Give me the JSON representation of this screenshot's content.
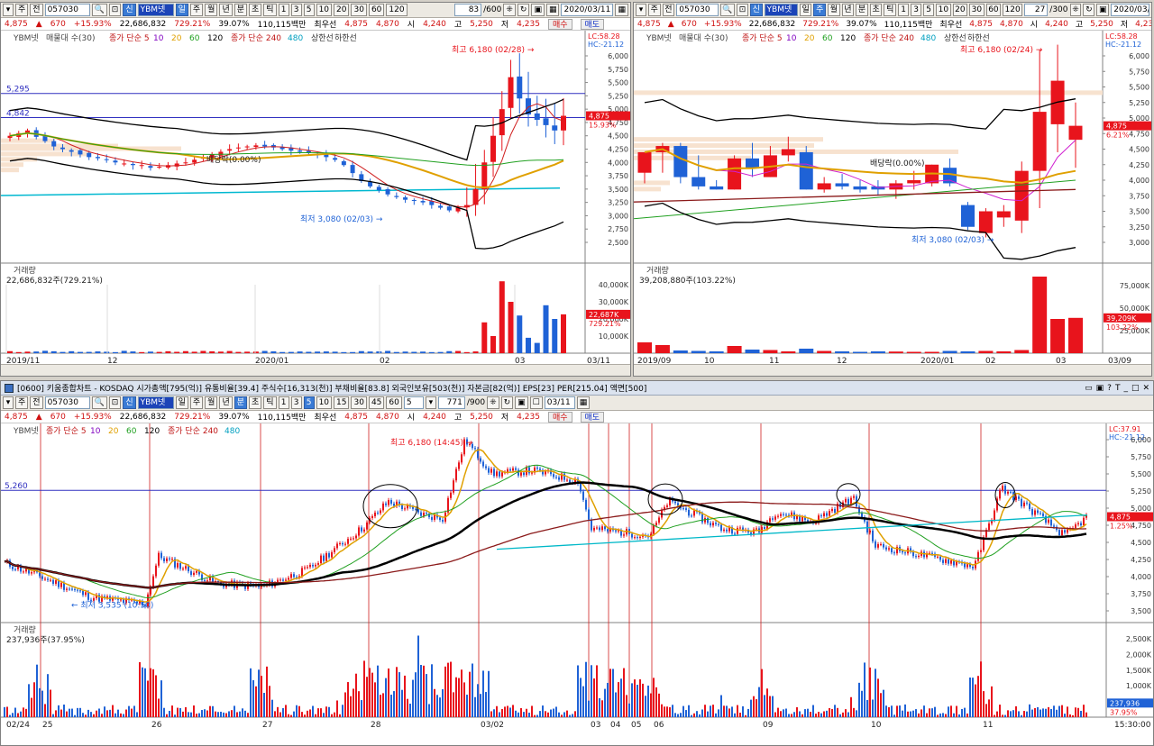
{
  "toolbar": {
    "code": "057030",
    "name": "YBM넷",
    "btn_stock": "주",
    "btn_prev": "전",
    "btn_new": "신",
    "periods": [
      "일",
      "주",
      "월",
      "년",
      "분",
      "초",
      "틱"
    ],
    "minutes": [
      "1",
      "3",
      "5",
      "10",
      "20",
      "30",
      "60",
      "120"
    ],
    "minutes_bottom": [
      "1",
      "3",
      "5",
      "10",
      "15",
      "30",
      "45",
      "60"
    ],
    "count_left": "83",
    "total_left": "/600",
    "count_right": "27",
    "total_right": "/300",
    "count_bottom": "771",
    "total_bottom": "/900",
    "minute_sel_bottom": "5",
    "date_left": "2020/03/11",
    "date_right": "2020/03/09",
    "date_bottom": "03/11"
  },
  "quote": {
    "price": "4,875",
    "change": "670",
    "pct": "+15.93%",
    "volume": "22,686,832",
    "vol_ratio": "729.21%",
    "turnover": "39.07%",
    "amount": "110,115백만",
    "best_label": "최우선",
    "ask": "4,875",
    "bid": "4,870",
    "open_label": "시",
    "open": "4,240",
    "high_label": "고",
    "high": "5,250",
    "low_label": "저",
    "low": "4,235",
    "buy": "매수",
    "sell": "매도"
  },
  "bottom_title": "[0600] 키움종합차트 - KOSDAQ 시가총액[795(억)] 유통비율[39.4] 주식수[16,313(천)] 부채비율[83.8] 외국인보유[503(천)] 자본금[82(억)] EPS[23] PER[215.04] 액면[500]",
  "colors": {
    "up": "#e8141c",
    "down": "#1f62d6",
    "panel": "#d4d0c8"
  },
  "charts": [
    {
      "id": "daily",
      "legend": {
        "name": "YBM넷",
        "ma_label": "매물대 수(30)",
        "ma1": "종가 단순 5",
        "p10": "10",
        "p20": "20",
        "p60": "60",
        "p120": "120",
        "ma2": "종가 단순 240",
        "p480": "480",
        "env": "상한선",
        "env2": "하한선"
      },
      "lc": "LC:58.28",
      "hc": "HC:-21.12",
      "y_ticks": [
        "6,000",
        "5,750",
        "5,500",
        "5,250",
        "5,000",
        "4,750",
        "4,500",
        "4,250",
        "4,000",
        "3,750",
        "3,500",
        "3,250",
        "3,000",
        "2,750",
        "2,500"
      ],
      "level1": "5,295",
      "level2": "4,842",
      "high_note": "최고 6,180 (02/28)",
      "low_note": "최저 3,080 (02/03)",
      "div_note": "배당락(0.00%)",
      "price_tag": "4,875",
      "pct_tag": "15.93%",
      "vol_label": "거래량",
      "vol_value": "22,686,832주(729.21%)",
      "vol_ticks": [
        "40,000K",
        "30,000K",
        "20,000K",
        "10,000K"
      ],
      "vol_tag": "22,687K",
      "vol_pct_tag": "729.21%",
      "x_labels": [
        "2019/11",
        "12",
        "2020/01",
        "02",
        "03",
        "03/11"
      ]
    },
    {
      "id": "weekly",
      "legend": {
        "name": "YBM넷",
        "ma_label": "매물대 수(30)",
        "ma1": "종가 단순 5",
        "p10": "10",
        "p20": "20",
        "p60": "60",
        "p120": "120",
        "ma2": "종가 단순 240",
        "p480": "480",
        "env": "상한선",
        "env2": "하한선"
      },
      "lc": "LC:58.28",
      "hc": "HC:-21.12",
      "y_ticks": [
        "6,000",
        "5,750",
        "5,500",
        "5,250",
        "5,000",
        "4,750",
        "4,500",
        "4,250",
        "4,000",
        "3,750",
        "3,500",
        "3,250",
        "3,000"
      ],
      "high_note": "최고 6,180 (02/24)",
      "low_note": "최저 3,080 (02/03)",
      "div_note": "배당락(0.00%)",
      "price_tag": "4,875",
      "pct_tag": "6.21%",
      "vol_label": "거래량",
      "vol_value": "39,208,880주(103.22%)",
      "vol_ticks": [
        "75,000K",
        "50,000K",
        "25,000K"
      ],
      "vol_tag": "39,209K",
      "vol_pct_tag": "103.22%",
      "x_labels": [
        "2019/09",
        "10",
        "11",
        "12",
        "2020/01",
        "02",
        "03",
        "03/09"
      ]
    },
    {
      "id": "minute",
      "legend": {
        "name": "YBM넷",
        "ma1": "종가 단순 5",
        "p10": "10",
        "p20": "20",
        "p60": "60",
        "p120": "120",
        "ma2": "종가 단순 240",
        "p480": "480"
      },
      "lc": "LC:37.91",
      "hc": "HC:-21.12",
      "y_ticks": [
        "6,000",
        "5,750",
        "5,500",
        "5,250",
        "5,000",
        "4,750",
        "4,500",
        "4,250",
        "4,000",
        "3,750",
        "3,500"
      ],
      "level1": "5,260",
      "high_note": "최고 6,180 (14:45)",
      "low_note": "최저 3,535 (10:50)",
      "price_tag": "4,875",
      "pct_tag": "1.25%",
      "vol_label": "거래량",
      "vol_value": "237,936주(37.95%)",
      "vol_ticks": [
        "2,500K",
        "2,000K",
        "1,500K",
        "1,000K",
        "500,000"
      ],
      "vol_tag": "237,936",
      "vol_pct_tag": "37.95%",
      "x_labels": [
        "02/24",
        "25",
        "26",
        "27",
        "28",
        "03/02",
        "03",
        "04",
        "05",
        "06",
        "09",
        "10",
        "11",
        "15:30:00"
      ]
    }
  ],
  "chart_data": [
    {
      "type": "candlestick",
      "chart_id": "daily",
      "title": "YBM넷 일봉",
      "y_unit": "KRW",
      "ylim": [
        2500,
        6000
      ],
      "x_range": [
        "2019/11",
        "2020/03/11"
      ],
      "ohlc_recent": [
        {
          "label": "03/11",
          "open": 4240,
          "high": 5250,
          "low": 4235,
          "close": 4875
        }
      ],
      "annotations": [
        {
          "text": "최고 6,180 (02/28)",
          "value": 6180
        },
        {
          "text": "최저 3,080 (02/03)",
          "value": 3080
        },
        {
          "text": "배당락(0.00%)"
        }
      ],
      "levels": [
        5295,
        4842
      ],
      "last_volume": 22686832
    },
    {
      "type": "candlestick",
      "chart_id": "weekly",
      "title": "YBM넷 주봉",
      "y_unit": "KRW",
      "ylim": [
        3000,
        6000
      ],
      "x_range": [
        "2019/09",
        "2020/03/09"
      ],
      "ohlc": [
        {
          "open": 4120,
          "high": 4350,
          "low": 3950,
          "close": 4450
        },
        {
          "open": 4450,
          "high": 4600,
          "low": 4120,
          "close": 4550
        },
        {
          "open": 4550,
          "high": 4600,
          "low": 3950,
          "close": 4050
        },
        {
          "open": 4050,
          "high": 4400,
          "low": 3850,
          "close": 3900
        },
        {
          "open": 3900,
          "high": 4000,
          "low": 3850,
          "close": 3850
        },
        {
          "open": 3850,
          "high": 4400,
          "low": 3850,
          "close": 4350
        },
        {
          "open": 4350,
          "high": 4600,
          "low": 4050,
          "close": 4200
        },
        {
          "open": 4050,
          "high": 4550,
          "low": 4050,
          "close": 4400
        },
        {
          "open": 4400,
          "high": 4700,
          "low": 4300,
          "close": 4500
        },
        {
          "open": 4450,
          "high": 4550,
          "low": 3850,
          "close": 3850
        },
        {
          "open": 3850,
          "high": 4050,
          "low": 3800,
          "close": 3950
        },
        {
          "open": 3950,
          "high": 4100,
          "low": 3850,
          "close": 3900
        },
        {
          "open": 3900,
          "high": 4000,
          "low": 3800,
          "close": 3850
        },
        {
          "open": 3900,
          "high": 4000,
          "low": 3750,
          "close": 3850
        },
        {
          "open": 3850,
          "high": 4000,
          "low": 3700,
          "close": 3950
        },
        {
          "open": 3950,
          "high": 4150,
          "low": 3850,
          "close": 4000
        },
        {
          "open": 3950,
          "high": 4250,
          "low": 3900,
          "close": 4250
        },
        {
          "open": 4200,
          "high": 4350,
          "low": 3900,
          "close": 3950
        },
        {
          "open": 3600,
          "high": 3650,
          "low": 3200,
          "close": 3250
        },
        {
          "open": 3150,
          "high": 3550,
          "low": 3080,
          "close": 3500
        },
        {
          "open": 3400,
          "high": 3600,
          "low": 3250,
          "close": 3500
        },
        {
          "open": 3350,
          "high": 4300,
          "low": 3150,
          "close": 4150
        },
        {
          "open": 4150,
          "high": 6100,
          "low": 3550,
          "close": 5100
        },
        {
          "open": 4900,
          "high": 6180,
          "low": 4450,
          "close": 5600
        },
        {
          "open": 4650,
          "high": 5250,
          "low": 4200,
          "close": 4875
        }
      ],
      "volume_k": [
        12000,
        9000,
        3000,
        2500,
        2000,
        8000,
        4000,
        3500,
        2000,
        5000,
        2500,
        2000,
        1500,
        2000,
        1800,
        1500,
        1500,
        2500,
        2000,
        2500,
        2000,
        3500,
        85000,
        38000,
        39209
      ]
    },
    {
      "type": "candlestick",
      "chart_id": "minute",
      "title": "YBM넷 5분봉",
      "y_unit": "KRW",
      "ylim": [
        3500,
        6000
      ],
      "x_range": [
        "02/24",
        "03/11 15:30:00"
      ],
      "annotations": [
        {
          "text": "최고 6,180 (14:45)",
          "value": 6180
        },
        {
          "text": "최저 3,535 (10:50)",
          "value": 3535
        }
      ],
      "levels": [
        5260
      ],
      "last_volume": 237936
    }
  ]
}
